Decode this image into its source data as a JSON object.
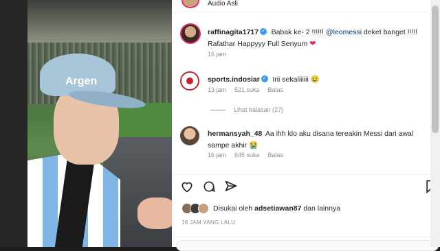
{
  "video": {
    "cap_text": "Argen",
    "mute_icon": "speaker-muted-icon"
  },
  "header": {
    "audio_label": "Audio Asli"
  },
  "post_caption": {
    "username": "raffinagita1717",
    "text_before": "Babak ke- 2 !!!!!! ",
    "mention": "@leomessi",
    "text_after": " deket banget !!!!!",
    "line2": "Rafathar Happyyy Full Senyum ",
    "emoji": "❤",
    "time": "16 jam"
  },
  "comments": [
    {
      "username": "sports.indosiar",
      "text": "Irii sekaliiiiii 😢",
      "time": "13 jam",
      "likes": "521 suka",
      "reply": "Balas"
    },
    {
      "username": "hermansyah_48",
      "text": "Aa ihh klo aku disana tereakin Messi dari awal sampe akhir 😭",
      "time": "16 jam",
      "likes": "645 suka",
      "reply": "Balas"
    }
  ],
  "view_replies": "Lihat balasan (27)",
  "actions": {
    "like_icon": "heart-icon",
    "comment_icon": "comment-icon",
    "share_icon": "send-icon",
    "save_icon": "bookmark-icon"
  },
  "likes": {
    "prefix": "Disukai oleh ",
    "user": "adsetiawan87",
    "suffix": " dan lainnya"
  },
  "posted_time": "16 JAM YANG LALU",
  "colors": {
    "accent_ring": "#e1306c",
    "verified": "#3897f0",
    "mention": "#00376b"
  }
}
